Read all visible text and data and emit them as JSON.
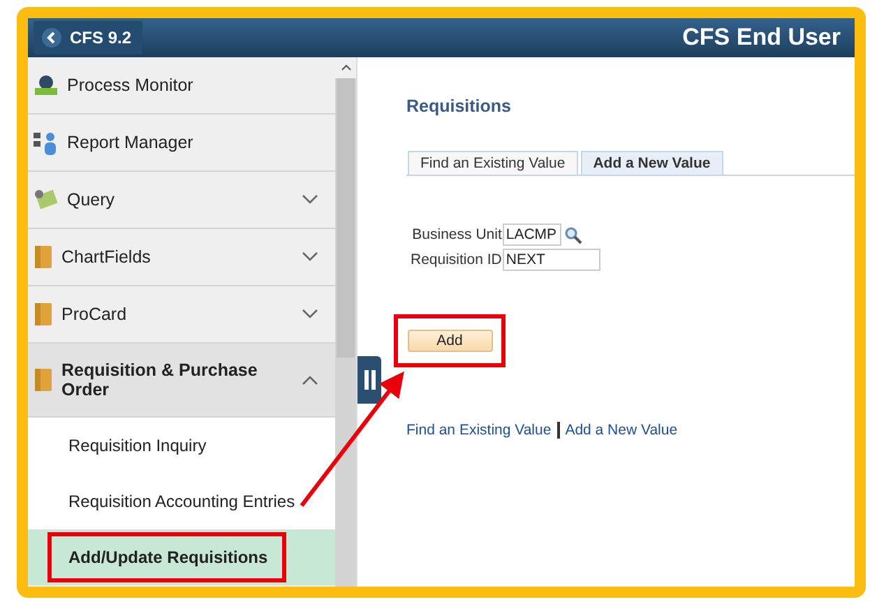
{
  "header": {
    "back": "CFS 9.2",
    "title": "CFS End User"
  },
  "sidebar": {
    "items": [
      {
        "label": "Process Monitor",
        "kind": "process"
      },
      {
        "label": "Report Manager",
        "kind": "report"
      },
      {
        "label": "Query",
        "kind": "query",
        "expanded": false
      },
      {
        "label": "ChartFields",
        "kind": "folder",
        "expanded": false
      },
      {
        "label": "ProCard",
        "kind": "folder",
        "expanded": false
      },
      {
        "label": "Requisition & Purchase Order",
        "kind": "folder",
        "expanded": true,
        "children": [
          {
            "label": "Requisition Inquiry",
            "selected": false,
            "highlighted": false
          },
          {
            "label": "Requisition Accounting Entries",
            "selected": false,
            "highlighted": false
          },
          {
            "label": "Add/Update Requisitions",
            "selected": true,
            "highlighted": true
          }
        ]
      }
    ]
  },
  "content": {
    "title": "Requisitions",
    "tabs": [
      {
        "label": "Find an Existing Value",
        "selected": false
      },
      {
        "label": "Add a New Value",
        "selected": true
      }
    ],
    "fields": [
      {
        "label": "Business Unit",
        "value": "LACMP",
        "lookup": true
      },
      {
        "label": "Requisition ID",
        "value": "NEXT",
        "lookup": false
      }
    ],
    "add_button": {
      "label": "Add",
      "highlighted": true
    },
    "links": [
      "Find an Existing Value",
      "Add a New Value"
    ]
  }
}
